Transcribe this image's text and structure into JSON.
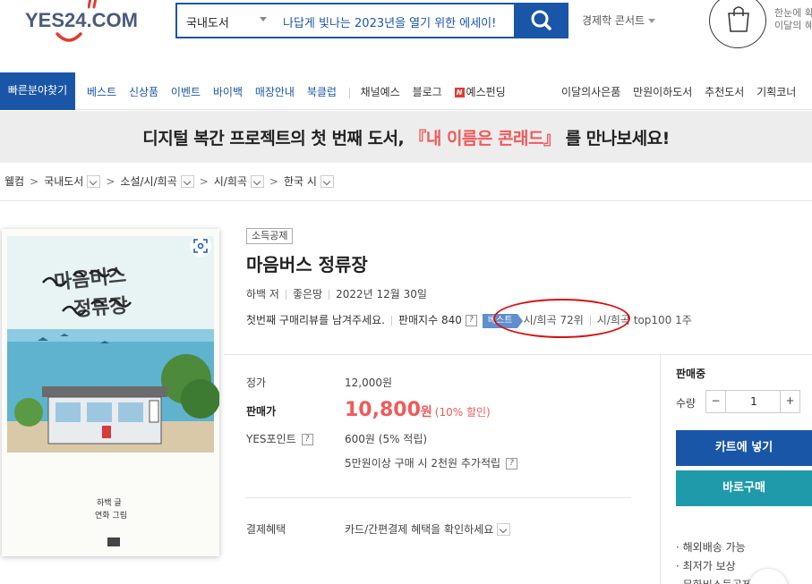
{
  "header": {
    "logo_text": "YES24.COM",
    "search_category": "국내도서",
    "search_query": "나답게 빛나는 2023년을 열기 위한 에세이!",
    "concert_link": "경제학 콘서트",
    "bag_text_line1": "한눈에 확",
    "bag_text_line2": "이달의 혜"
  },
  "nav": {
    "quick": "빠른분야찾기",
    "items": [
      "베스트",
      "신상품",
      "이벤트",
      "바이백",
      "매장안내",
      "북클럽"
    ],
    "items2": [
      "채널예스",
      "블로그",
      "예스펀딩"
    ],
    "n_badge": "N",
    "right_items": [
      "이달의사은품",
      "만원이하도서",
      "추천도서",
      "기획코너"
    ]
  },
  "banner": {
    "prefix": "디지털 복간 프로젝트의 첫 번째 도서, ",
    "highlight": "『내 이름은 콘래드』",
    "suffix": " 를 만나보세요!"
  },
  "breadcrumb": {
    "home": "웰컴",
    "levels": [
      "국내도서",
      "소설/시/희곡",
      "시/희곡",
      "한국 시"
    ]
  },
  "book": {
    "tag": "소득공제",
    "title": "마음버스 정류장",
    "author": "하백 저",
    "publisher": "좋은땅",
    "date": "2022년 12월 30일",
    "review_prompt": "첫번째 구매리뷰를 남겨주세요.",
    "sales_index": "판매지수 840",
    "help": "?",
    "best_tag": "베스트",
    "rank1": "시/희곡 72위",
    "rank2": "시/희곡 top100 1주",
    "cover_title_line1": "마음버스",
    "cover_title_line2": "정류장",
    "cover_author": "하백 글",
    "cover_illustrator": "연화 그림"
  },
  "price": {
    "list_label": "정가",
    "list_price": "12,000원",
    "sale_label": "판매가",
    "sale_number": "10,800",
    "sale_won": "원",
    "discount": "(10% 할인)",
    "point_label": "YES포인트",
    "point_value": "600원 (5% 적립)",
    "point_extra": "5만원이상 구매 시 2천원 추가적립",
    "benefit_label": "결제혜택",
    "benefit_value": "카드/간편결제 혜택을 확인하세요"
  },
  "purchase": {
    "status": "판매중",
    "qty_label": "수량",
    "qty_value": "1",
    "minus": "−",
    "plus": "+",
    "cart_button": "카트에 넣기",
    "buy_button": "바로구매",
    "notes": [
      "· 해외배송 가능",
      "· 최저가 보상",
      "· 문화비소득공제 가능"
    ]
  },
  "colors": {
    "brand_blue": "#1a56a8",
    "buy_teal": "#1e9aaa",
    "sale_red": "#f05a5a",
    "annotation_red": "#d91010"
  }
}
